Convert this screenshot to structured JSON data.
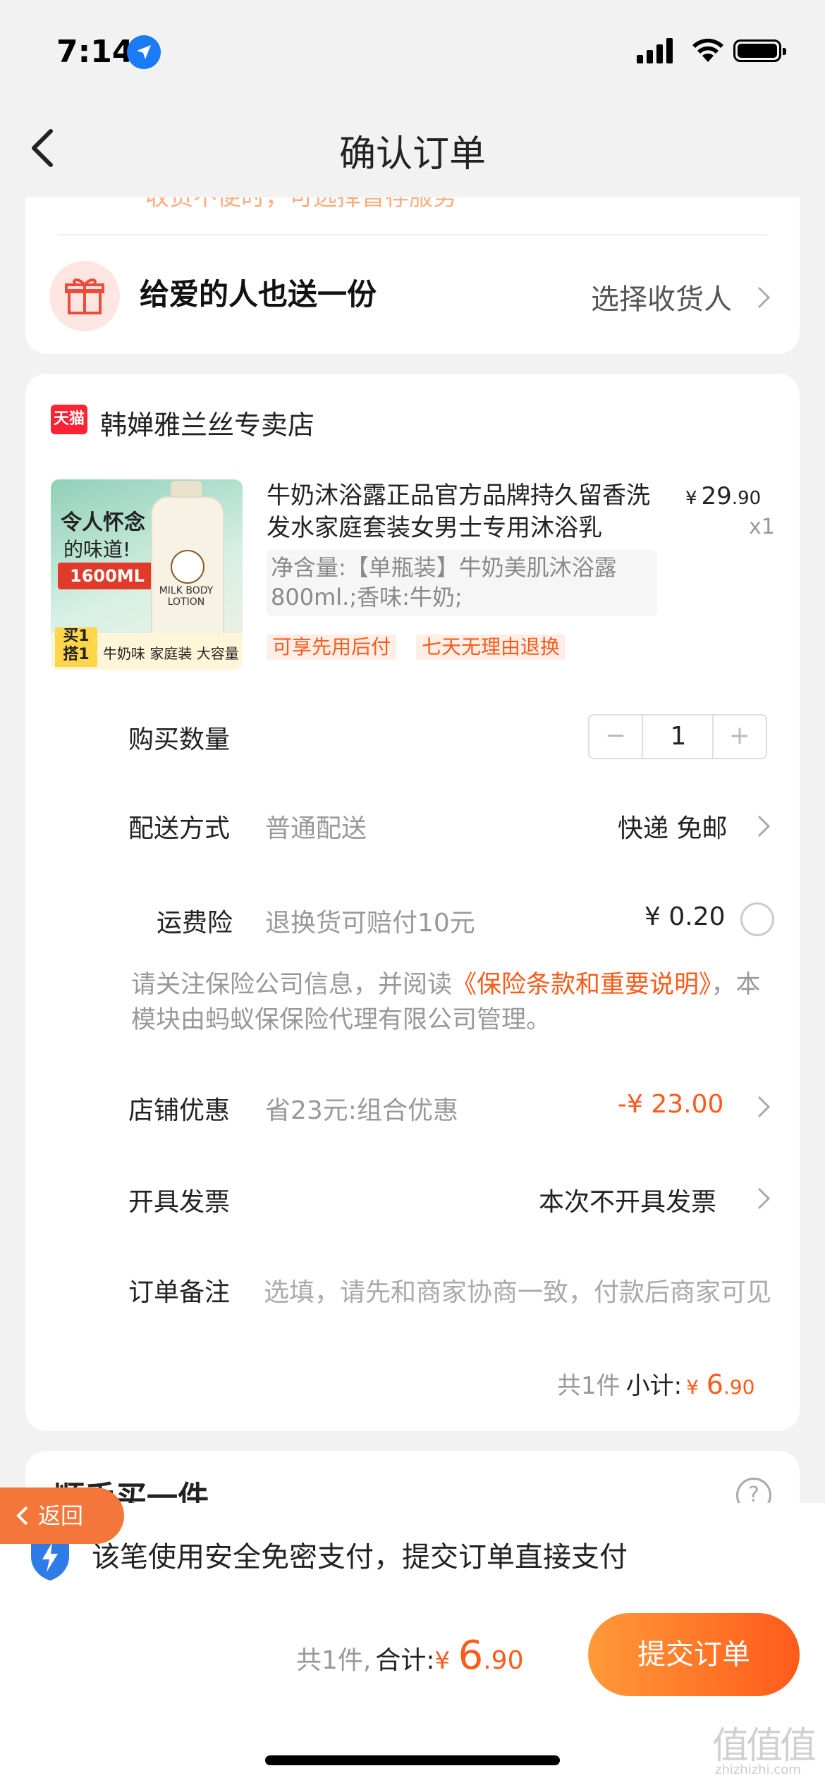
{
  "status_bar": {
    "time": "7:14"
  },
  "header": {
    "title": "确认订单"
  },
  "card_top": {
    "strip_text": "收货不便时，可选择暂存服务"
  },
  "gift": {
    "title": "给爱的人也送一份",
    "link": "选择收货人"
  },
  "shop": {
    "badge": "天猫",
    "name": "韩婵雅兰丝专卖店"
  },
  "product": {
    "image_text": {
      "line1": "令人怀念",
      "line2": "的味道!",
      "volume": "1600ML",
      "bottle_label": "MILK BODY LOTION",
      "buy_line1": "买1",
      "buy_line2": "搭1",
      "bar_text": "牛奶味 家庭装 大容量"
    },
    "title": "牛奶沐浴露正品官方品牌持久留香洗发水家庭套装女男士专用沐浴乳",
    "price_symbol": "¥",
    "price_int": "29",
    "price_dec": ".90",
    "quantity": "x1",
    "spec": "净含量:【单瓶装】牛奶美肌沐浴露800ml.;香味:牛奶;",
    "tags": [
      "可享先用后付",
      "七天无理由退换"
    ]
  },
  "rows": {
    "qty_label": "购买数量",
    "qty_value": "1",
    "qty_minus": "−",
    "qty_plus": "+",
    "shipping_label": "配送方式",
    "shipping_sub": "普通配送",
    "shipping_value": "快递 免邮",
    "insurance_label": "运费险",
    "insurance_sub": "退换货可赔付10元",
    "insurance_value": "¥ 0.20",
    "insurance_note_pre": "请关注保险公司信息，并阅读",
    "insurance_note_link": "《保险条款和重要说明》",
    "insurance_note_post": "，本模块由蚂蚁保保险代理有限公司管理。",
    "discount_label": "店铺优惠",
    "discount_sub": "省23元:组合优惠",
    "discount_value": "-¥ 23.00",
    "invoice_label": "开具发票",
    "invoice_value": "本次不开具发票",
    "remark_label": "订单备注",
    "remark_placeholder": "选填，请先和商家协商一致，付款后商家可见"
  },
  "subtotal": {
    "count": "共1件",
    "label": "小计:",
    "symbol": "¥",
    "int": "6",
    "dec": ".90"
  },
  "addon": {
    "title": "顺手买一件",
    "help": "?"
  },
  "return_button": {
    "label": "返回"
  },
  "bottom": {
    "pay_note": "该笔使用安全免密支付，提交订单直接支付",
    "count": "共1件,",
    "label": "合计:",
    "symbol": "¥",
    "int": "6",
    "dec": ".90",
    "submit": "提交订单"
  },
  "watermark": {
    "main": "值值值",
    "sub": "zhizhizhi.com"
  },
  "colors": {
    "accent": "#ff5a1a",
    "tmall_red": "#ff2233",
    "background": "#f2f2f2"
  }
}
